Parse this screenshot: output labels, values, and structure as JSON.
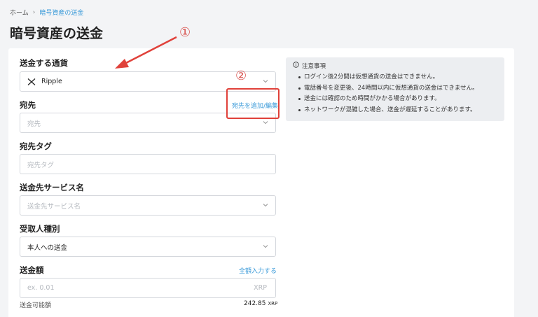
{
  "breadcrumb": {
    "home": "ホーム",
    "separator": "›",
    "current": "暗号資産の送金"
  },
  "page_title": "暗号資産の送金",
  "form": {
    "currency": {
      "label": "送金する通貨",
      "value": "Ripple",
      "icon": "xrp-icon"
    },
    "destination": {
      "label": "宛先",
      "placeholder": "宛先",
      "edit_link": "宛先を追加/編集"
    },
    "destination_tag": {
      "label": "宛先タグ",
      "placeholder": "宛先タグ"
    },
    "service_name": {
      "label": "送金先サービス名",
      "placeholder": "送金先サービス名"
    },
    "recipient_type": {
      "label": "受取人種別",
      "value": "本人への送金"
    },
    "amount": {
      "label": "送金額",
      "placeholder": "ex. 0.01",
      "unit": "XRP",
      "full_amount_link": "全額入力する",
      "available_label": "送金可能額",
      "available_value": "242.85",
      "available_unit": "XRP"
    }
  },
  "notice": {
    "title": "注意事項",
    "items": [
      "ログイン後2分間は仮想通貨の送金はできません。",
      "電話番号を変更後、24時間以内に仮想通貨の送金はできません。",
      "送金には確認のため時間がかかる場合があります。",
      "ネットワークが混雑した場合、送金が遅延することがあります。"
    ]
  },
  "annotations": {
    "one": "①",
    "two": "②"
  },
  "colors": {
    "accent": "#3a9ad9",
    "annotation": "#e0413a"
  }
}
